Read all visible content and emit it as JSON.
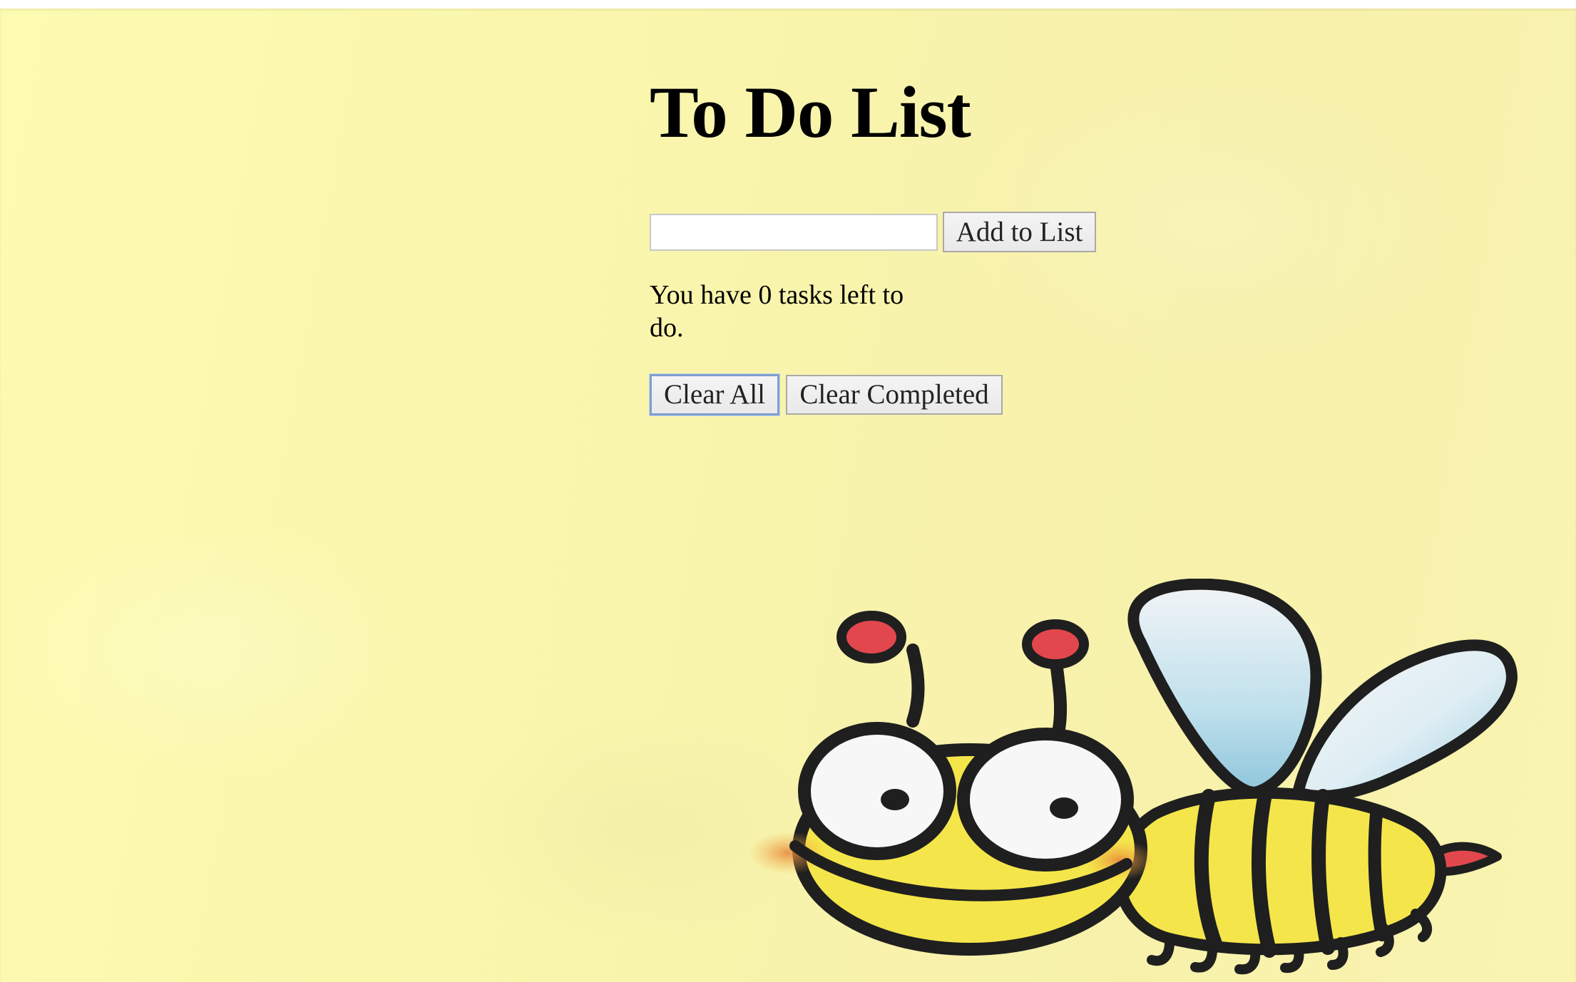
{
  "app": {
    "title": "To Do List"
  },
  "add_form": {
    "input_value": "",
    "input_placeholder": "",
    "add_button_label": "Add to List"
  },
  "status": {
    "line": "You have 0 tasks left to do.",
    "tasks_left": 0
  },
  "actions": {
    "clear_all_label": "Clear All",
    "clear_completed_label": "Clear Completed"
  },
  "illustration": {
    "name": "bee-illustration"
  },
  "colors": {
    "background": "#faf7ad",
    "bee_body": "#f4e64a",
    "bee_outline": "#1f1f1f",
    "antenna_tip": "#e2474d",
    "wing": "#a9d6e6"
  }
}
